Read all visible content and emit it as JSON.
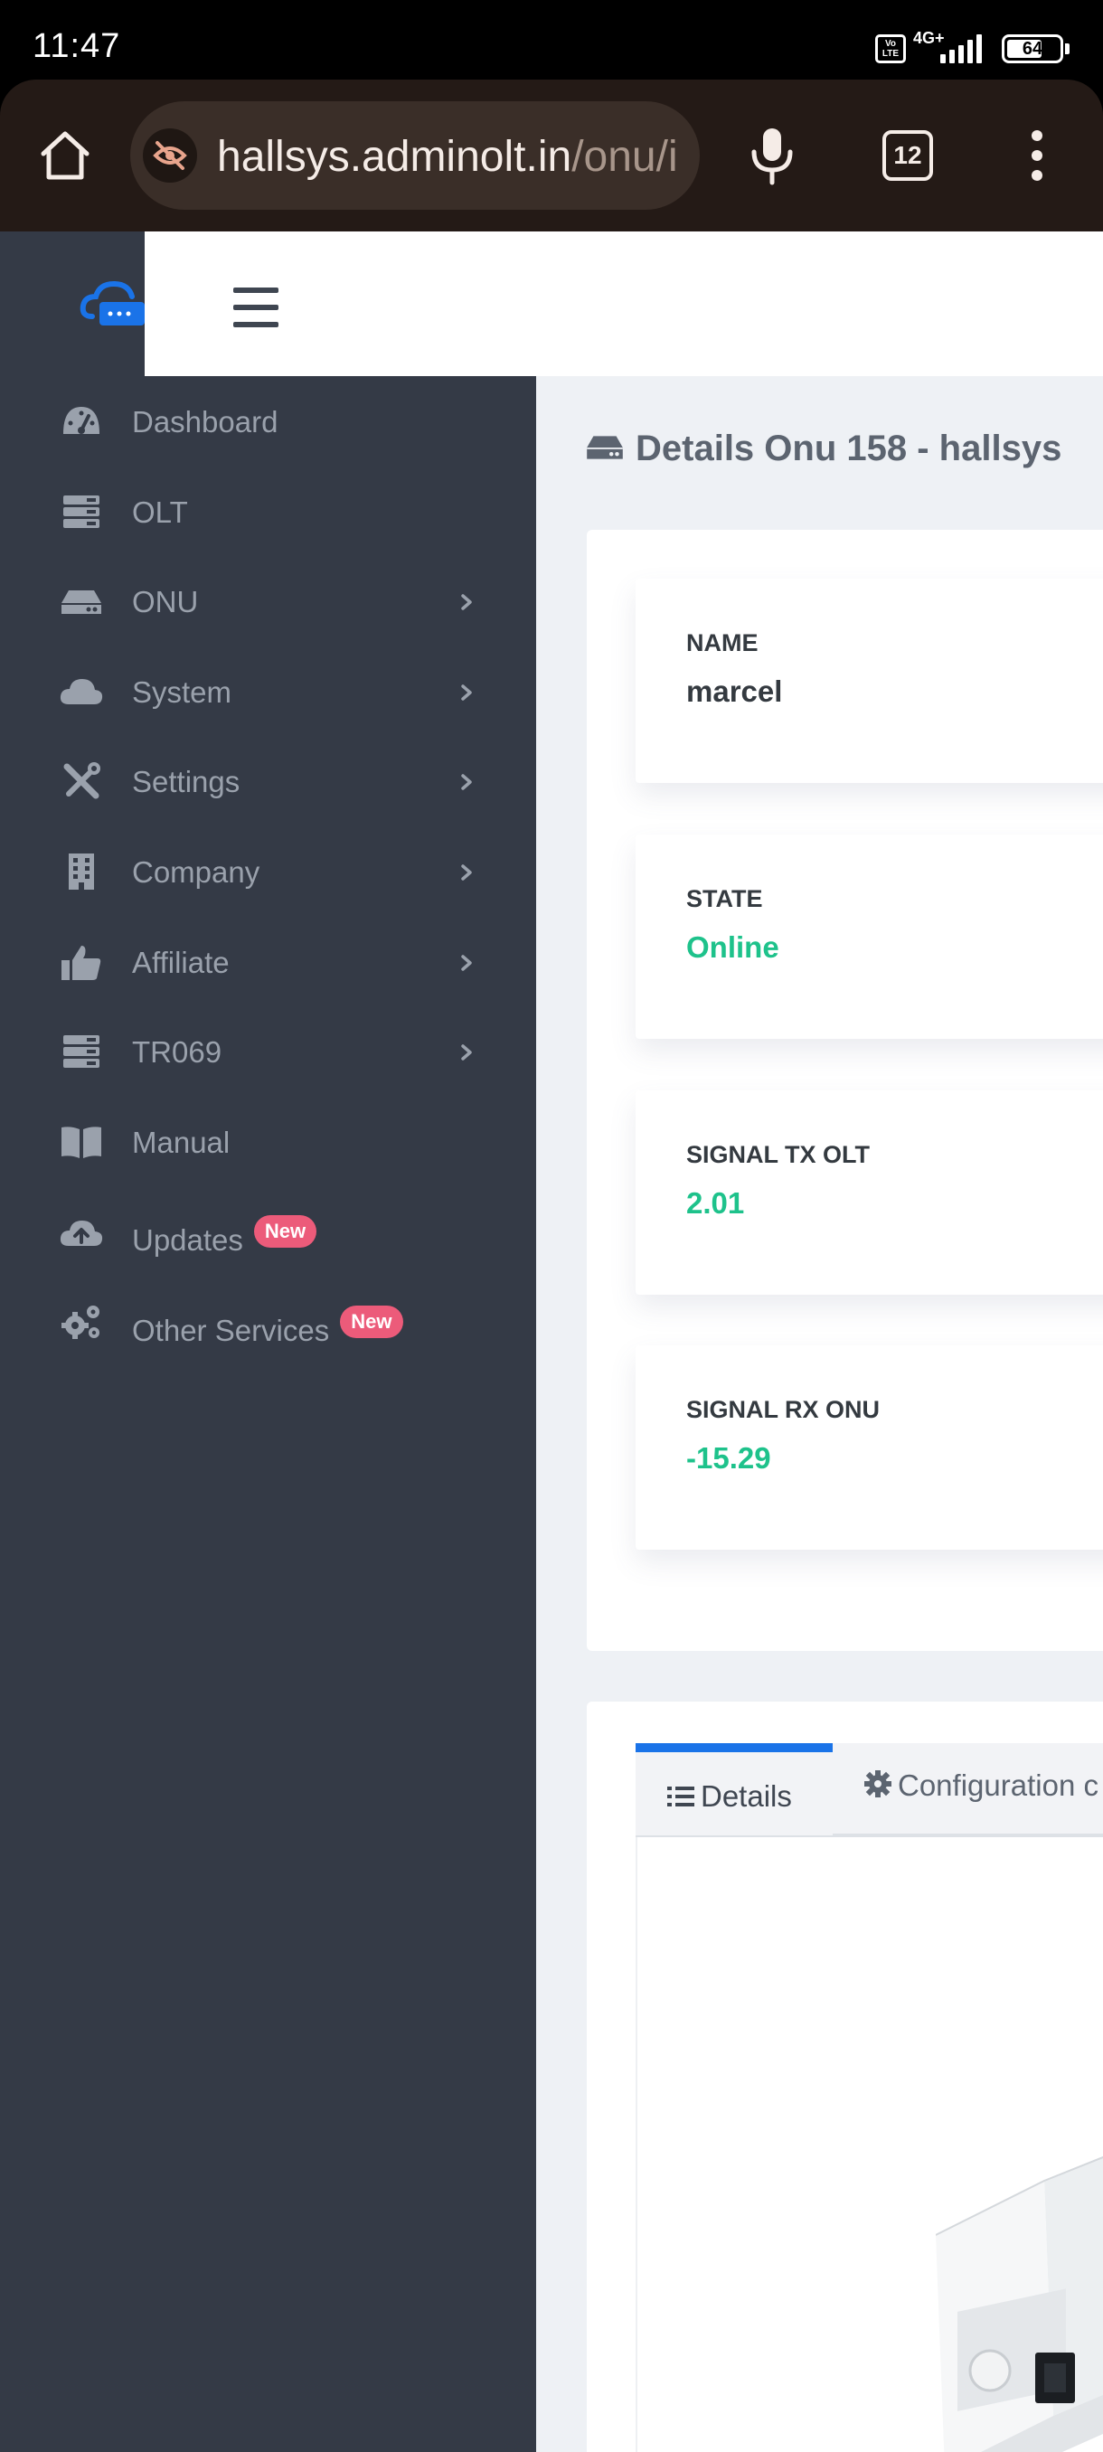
{
  "status_bar": {
    "time": "11:47",
    "volte": "Vo LTE",
    "network": "4G+",
    "battery": "64"
  },
  "browser": {
    "url_domain": "hallsys.adminolt.in",
    "url_path": "/onu/i",
    "tab_count": "12",
    "icons": [
      "home-icon",
      "incognito-eye-off-icon",
      "mic-icon",
      "tabs-icon",
      "more-vert-icon"
    ]
  },
  "sidebar": {
    "items": [
      {
        "label": "Dashboard",
        "icon": "dashboard-gauge-icon",
        "has_chevron": false
      },
      {
        "label": "OLT",
        "icon": "server-icon",
        "has_chevron": false
      },
      {
        "label": "ONU",
        "icon": "hdd-icon",
        "has_chevron": true
      },
      {
        "label": "System",
        "icon": "cloud-icon",
        "has_chevron": true
      },
      {
        "label": "Settings",
        "icon": "tools-icon",
        "has_chevron": true
      },
      {
        "label": "Company",
        "icon": "building-icon",
        "has_chevron": true
      },
      {
        "label": "Affiliate",
        "icon": "thumbs-up-icon",
        "has_chevron": true
      },
      {
        "label": "TR069",
        "icon": "server-icon",
        "has_chevron": true
      },
      {
        "label": "Manual",
        "icon": "book-icon",
        "has_chevron": false
      },
      {
        "label": "Updates",
        "icon": "cloud-upload-icon",
        "badge": "New",
        "has_chevron": false
      },
      {
        "label": "Other Services",
        "icon": "cogs-icon",
        "badge": "New",
        "has_chevron": false
      }
    ]
  },
  "main": {
    "title": "Details Onu 158 - hallsys",
    "cards": [
      {
        "label": "NAME",
        "value": "marcel"
      },
      {
        "label": "STATE",
        "value": "Online"
      },
      {
        "label": "SIGNAL TX OLT",
        "value": "2.01"
      },
      {
        "label": "SIGNAL RX ONU",
        "value": "-15.29"
      }
    ],
    "tabs": [
      {
        "label": "Details",
        "icon": "list-icon",
        "active": true
      },
      {
        "label": "Configuration c",
        "icon": "gear-icon",
        "active": false
      }
    ]
  },
  "colors": {
    "sidebar_bg": "#343a46",
    "accent_blue": "#1a73e8",
    "value_green": "#1ec28b",
    "badge_pink": "#ec5b7a",
    "browser_bg": "#241a16"
  }
}
